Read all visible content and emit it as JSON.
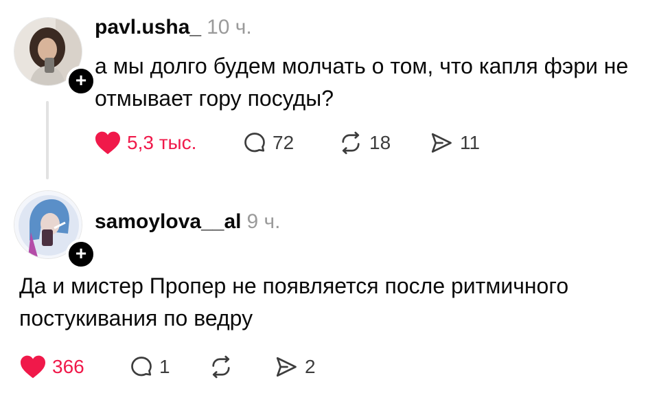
{
  "colors": {
    "like_active": "#f0194a",
    "text_primary": "#0a0a0a",
    "text_secondary": "#9a9a9a",
    "follow_button": "#000000"
  },
  "posts": [
    {
      "username": "pavl.usha_",
      "time": "10 ч.",
      "text": "а мы долго будем молчать о том, что капля фэри не отмывает гору посуды?",
      "follow_icon": "+",
      "liked": true,
      "actions": {
        "likes": "5,3 тыс.",
        "replies": "72",
        "reposts": "18",
        "shares": "11"
      }
    },
    {
      "username": "samoylova__al",
      "time": "9 ч.",
      "text": "Да и мистер Пропер не появляется после ритмичного постукивания по ведру",
      "follow_icon": "+",
      "liked": true,
      "actions": {
        "likes": "366",
        "replies": "1",
        "reposts": "",
        "shares": "2"
      }
    }
  ]
}
